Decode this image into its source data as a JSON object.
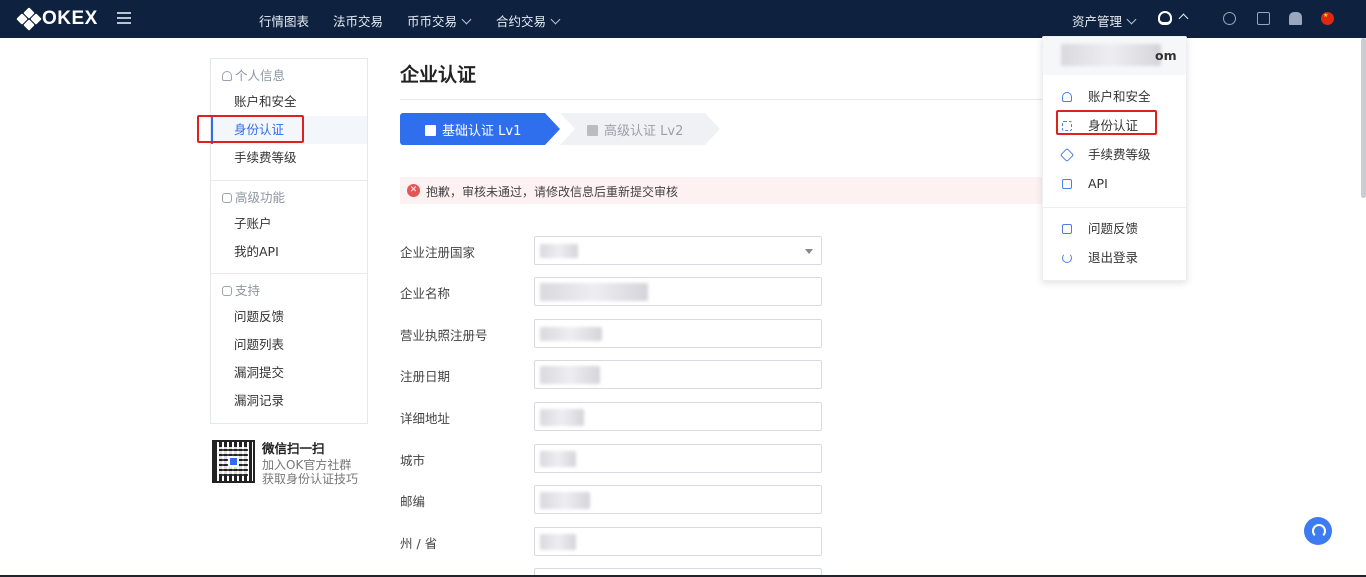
{
  "header": {
    "logo": "OKEX",
    "nav": [
      {
        "label": "行情图表",
        "has_dropdown": false
      },
      {
        "label": "法币交易",
        "has_dropdown": false
      },
      {
        "label": "币币交易",
        "has_dropdown": true
      },
      {
        "label": "合约交易",
        "has_dropdown": true
      }
    ],
    "assets_label": "资产管理",
    "icons": [
      "menu-icon",
      "user-icon",
      "chat-icon",
      "download-icon",
      "bell-icon",
      "flag-cn-icon"
    ]
  },
  "sidebar": {
    "groups": [
      {
        "title": "个人信息",
        "icon": "user-icon",
        "items": [
          "账户和安全",
          "身份认证",
          "手续费等级"
        ]
      },
      {
        "title": "高级功能",
        "icon": "cube-icon",
        "items": [
          "子账户",
          "我的API"
        ]
      },
      {
        "title": "支持",
        "icon": "support-icon",
        "items": [
          "问题反馈",
          "问题列表",
          "漏洞提交",
          "漏洞记录"
        ]
      }
    ],
    "active_item": "身份认证",
    "qr": {
      "title": "微信扫一扫",
      "line1": "加入OK官方社群",
      "line2": "获取身份认证技巧"
    }
  },
  "main": {
    "title": "企业认证",
    "steps": [
      {
        "label": "基础认证 Lv1",
        "active": true
      },
      {
        "label": "高级认证 Lv2",
        "active": false
      }
    ],
    "alert": "抱歉，审核未通过，请修改信息后重新提交审核",
    "form": [
      {
        "label": "企业注册国家",
        "type": "select"
      },
      {
        "label": "企业名称",
        "type": "text"
      },
      {
        "label": "营业执照注册号",
        "type": "text"
      },
      {
        "label": "注册日期",
        "type": "text"
      },
      {
        "label": "详细地址",
        "type": "text"
      },
      {
        "label": "城市",
        "type": "text"
      },
      {
        "label": "邮编",
        "type": "text"
      },
      {
        "label": "州 / 省",
        "type": "text"
      }
    ]
  },
  "dropdown": {
    "email_suffix": "om",
    "items": [
      {
        "label": "账户和安全",
        "icon": "user-icon"
      },
      {
        "label": "身份认证",
        "icon": "id-scan-icon"
      },
      {
        "label": "手续费等级",
        "icon": "diamond-icon"
      },
      {
        "label": "API",
        "icon": "monitor-icon"
      },
      {
        "label": "问题反馈",
        "icon": "edit-icon"
      },
      {
        "label": "退出登录",
        "icon": "power-icon"
      }
    ]
  },
  "colors": {
    "nav_bg": "#0e2240",
    "accent": "#2f6fed",
    "alert_bg": "#fdf1f1",
    "highlight": "#e0201e"
  }
}
